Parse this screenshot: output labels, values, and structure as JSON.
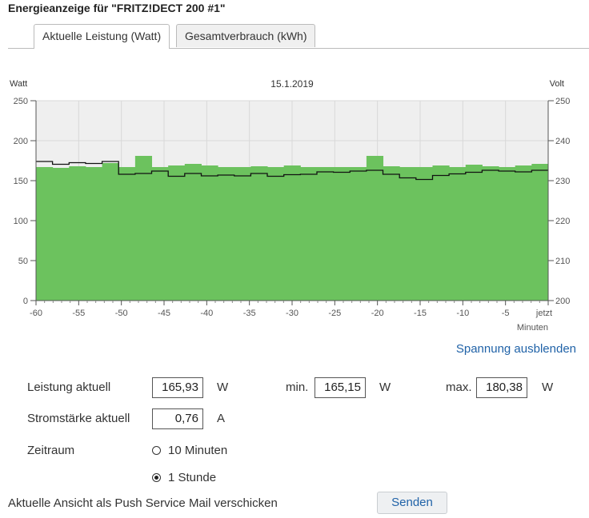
{
  "page": {
    "title": "Energieanzeige für \"FRITZ!DECT 200 #1\""
  },
  "tabs": [
    {
      "label": "Aktuelle Leistung (Watt)",
      "active": true
    },
    {
      "label": "Gesamtverbrauch (kWh)",
      "active": false
    }
  ],
  "chart_data": {
    "type": "bar",
    "title": "15.1.2019",
    "ylabel_left": "Watt",
    "ylabel_right": "Volt",
    "xlabel": "Minuten",
    "x_ticks": [
      "-60",
      "-55",
      "-50",
      "-45",
      "-40",
      "-35",
      "-30",
      "-25",
      "-20",
      "-15",
      "-10",
      "-5",
      "jetzt"
    ],
    "ylim_left": [
      0,
      250
    ],
    "yticks_left": [
      0,
      50,
      100,
      150,
      200,
      250
    ],
    "ylim_right": [
      200,
      250
    ],
    "yticks_right": [
      200,
      210,
      220,
      230,
      240,
      250
    ],
    "grid": true,
    "bar_color": "#6cc25e",
    "series": [
      {
        "type": "bar",
        "x": [
          -60,
          -58,
          -56,
          -54,
          -52,
          -50,
          -48,
          -46,
          -44,
          -42,
          -40,
          -38,
          -36,
          -34,
          -32,
          -30,
          -28,
          -26,
          -24,
          -22,
          -20,
          -18,
          -16,
          -14,
          -12,
          -10,
          -8,
          -6,
          -4,
          -2,
          0
        ],
        "values": [
          167,
          166,
          168,
          167,
          172,
          167,
          181,
          167,
          169,
          171,
          169,
          167,
          167,
          168,
          167,
          169,
          167,
          167,
          167,
          167,
          181,
          168,
          167,
          167,
          169,
          167,
          170,
          168,
          167,
          169,
          171
        ]
      },
      {
        "type": "step-line",
        "axis": "right",
        "x": [
          -60,
          -58,
          -56,
          -54,
          -52,
          -50,
          -48,
          -46,
          -44,
          -42,
          -40,
          -38,
          -36,
          -34,
          -32,
          -30,
          -28,
          -26,
          -24,
          -22,
          -20,
          -18,
          -16,
          -14,
          -12,
          -10,
          -8,
          -6,
          -4,
          -2,
          0
        ],
        "values": [
          234.8,
          234.1,
          234.5,
          234.3,
          234.8,
          231.6,
          231.8,
          232.4,
          231.1,
          231.8,
          231.2,
          231.4,
          231.2,
          231.8,
          231.1,
          231.5,
          231.6,
          232.2,
          232.1,
          232.4,
          232.6,
          231.6,
          230.7,
          230.3,
          231.3,
          231.7,
          232.1,
          232.6,
          232.4,
          232.2,
          232.6
        ]
      }
    ]
  },
  "spannung_toggle": {
    "label": "Spannung ausblenden"
  },
  "stats": {
    "leistung_label": "Leistung aktuell",
    "leistung_value": "165,93",
    "leistung_unit": "W",
    "min_label": "min.",
    "min_value": "165,15",
    "min_unit": "W",
    "max_label": "max.",
    "max_value": "180,38",
    "max_unit": "W",
    "strom_label": "Stromstärke aktuell",
    "strom_value": "0,76",
    "strom_unit": "A"
  },
  "zeitraum": {
    "label": "Zeitraum",
    "options": [
      {
        "label": "10 Minuten",
        "checked": false
      },
      {
        "label": "1 Stunde",
        "checked": true
      }
    ]
  },
  "push": {
    "label": "Aktuelle Ansicht als Push Service Mail verschicken",
    "button": "Senden"
  }
}
